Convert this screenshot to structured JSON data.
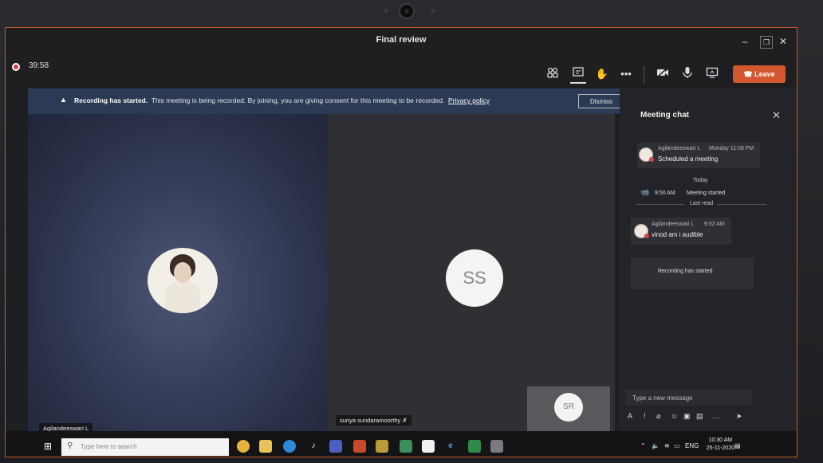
{
  "window": {
    "title": "Final review"
  },
  "meeting": {
    "timer": "39:58",
    "leave_label": "Leave",
    "controls": [
      "participants-icon",
      "chat-icon",
      "raise-hand-icon",
      "more-icon",
      "camera-icon",
      "mic-icon",
      "share-icon"
    ]
  },
  "banner": {
    "strong": "Recording has started.",
    "text": "This meeting is being recorded. By joining, you are giving consent for this meeting to be recorded.",
    "link": "Privacy policy",
    "dismiss_label": "Dismiss"
  },
  "participants": {
    "local_name": "Agilandeeswari L",
    "remote_name": "suriya sundaramoorthy",
    "remote_initials": "SS",
    "self_initials": "SR"
  },
  "chat": {
    "title": "Meeting chat",
    "messages": [
      {
        "author": "Agilandeeswari L",
        "time": "Monday 11:08 PM",
        "text": "Scheduled a meeting"
      }
    ],
    "today_label": "Today",
    "event_time": "9:50 AM",
    "event_text": "Meeting started",
    "last_read": "Last read",
    "message2": {
      "author": "Agilandeeswari L",
      "time": "9:52 AM",
      "text": "vinod am i audible"
    },
    "system": "Recording has started",
    "compose_placeholder": "Type a new message"
  },
  "taskbar": {
    "search_placeholder": "Type here to search",
    "lang": "ENG",
    "time": "10:30 AM",
    "date": "25-11-2020"
  },
  "colors": {
    "leave": "#d4582f",
    "banner": "#2b3a55",
    "recording": "#d23b3b"
  }
}
